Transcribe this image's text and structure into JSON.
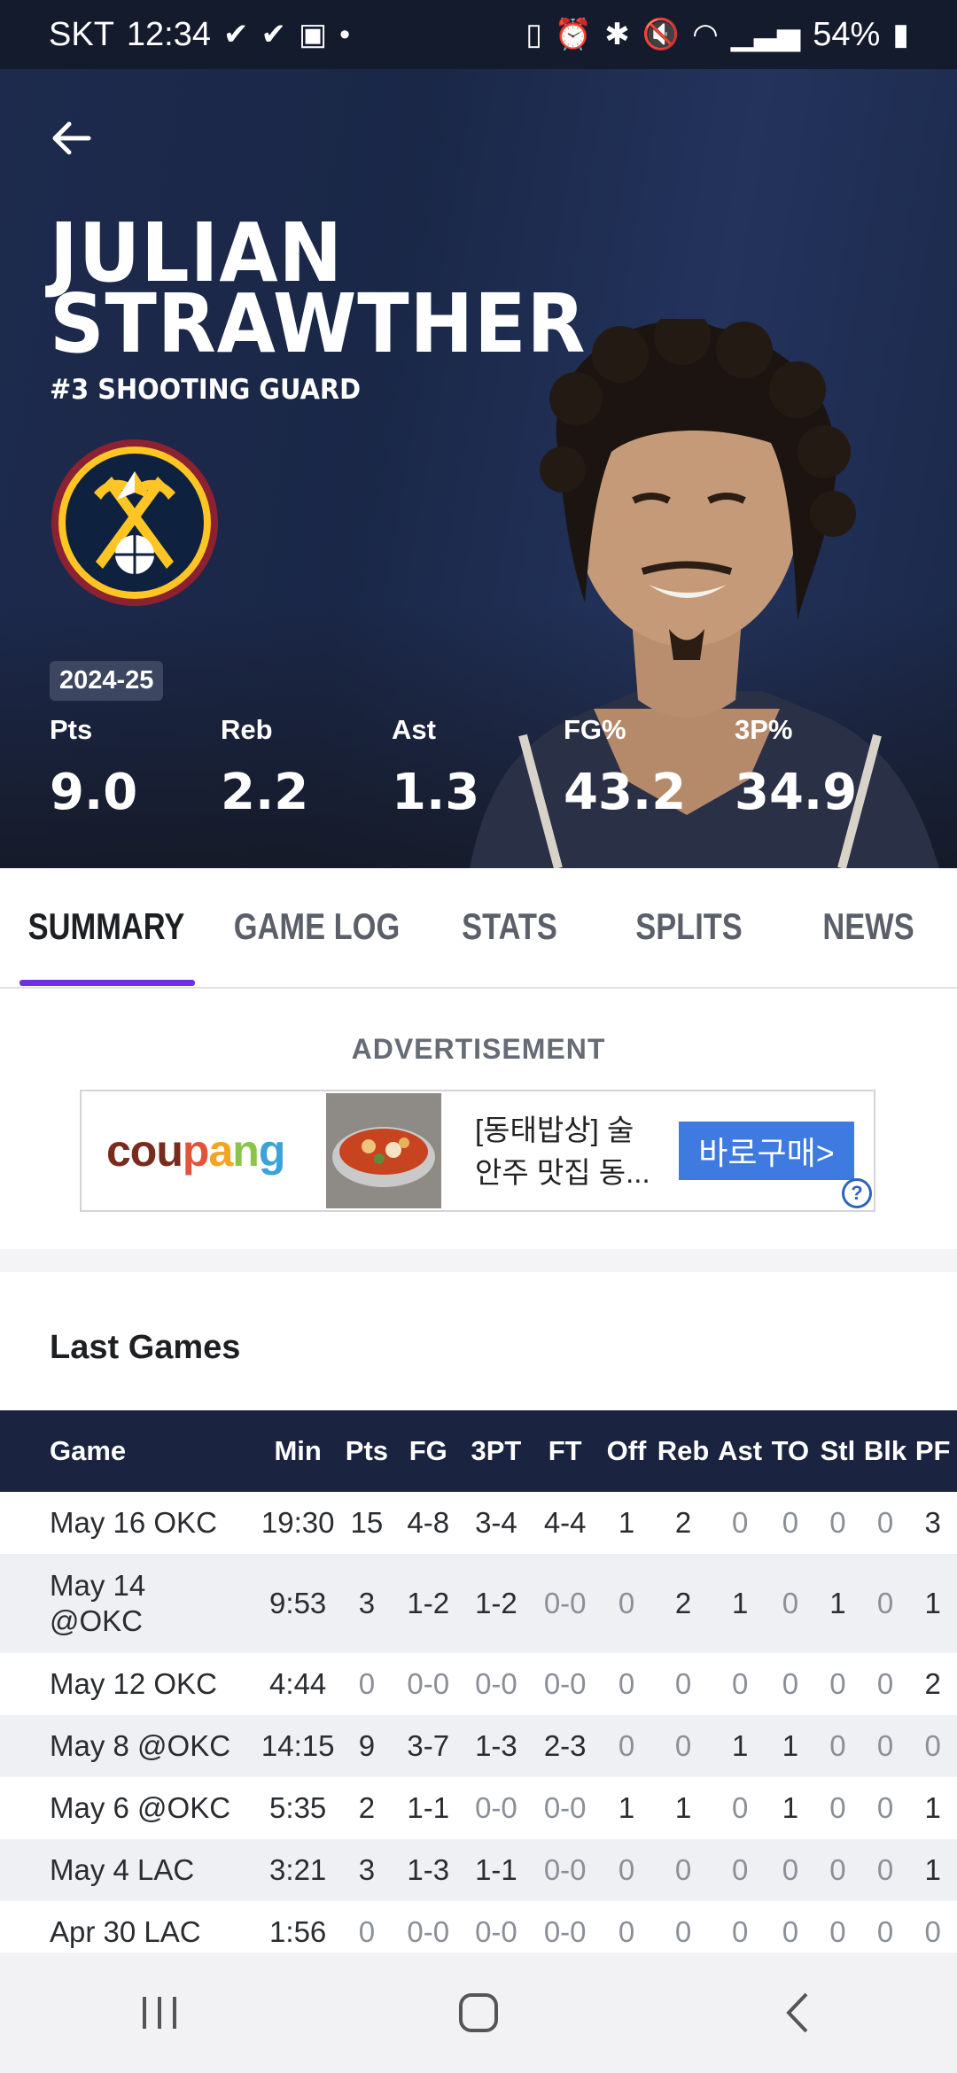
{
  "status_bar": {
    "carrier": "SKT",
    "time": "12:34",
    "battery": "54%",
    "left_icons": [
      "check-icon",
      "check-icon",
      "image-icon",
      "dot-icon"
    ],
    "right_icons": [
      "nfc-icon",
      "alarm-icon",
      "bluetooth-icon",
      "mute-icon",
      "wifi-icon",
      "signal-icon",
      "battery-icon"
    ]
  },
  "player": {
    "first_name": "JULIAN",
    "last_name": "STRAWTHER",
    "position": "#3 SHOOTING GUARD"
  },
  "season": "2024-25",
  "season_stats": [
    {
      "label": "Pts",
      "value": "9.0"
    },
    {
      "label": "Reb",
      "value": "2.2"
    },
    {
      "label": "Ast",
      "value": "1.3"
    },
    {
      "label": "FG%",
      "value": "43.2"
    },
    {
      "label": "3P%",
      "value": "34.9"
    }
  ],
  "tabs": [
    {
      "label": "SUMMARY",
      "active": true
    },
    {
      "label": "GAME LOG",
      "active": false
    },
    {
      "label": "STATS",
      "active": false
    },
    {
      "label": "SPLITS",
      "active": false
    },
    {
      "label": "NEWS",
      "active": false
    }
  ],
  "ad": {
    "label": "ADVERTISEMENT",
    "brand": "coupang",
    "text_line1": "[동태밥상] 술",
    "text_line2": "안주 맛집 동...",
    "cta": "바로구매>",
    "help": "?"
  },
  "last_games": {
    "title": "Last Games",
    "columns": [
      "Game",
      "Min",
      "Pts",
      "FG",
      "3PT",
      "FT",
      "Off",
      "Reb",
      "Ast",
      "TO",
      "Stl",
      "Blk",
      "PF"
    ],
    "rows": [
      [
        "May 16 OKC",
        "19:30",
        "15",
        "4-8",
        "3-4",
        "4-4",
        "1",
        "2",
        "0",
        "0",
        "0",
        "0",
        "3"
      ],
      [
        "May 14 @OKC",
        "9:53",
        "3",
        "1-2",
        "1-2",
        "0-0",
        "0",
        "2",
        "1",
        "0",
        "1",
        "0",
        "1"
      ],
      [
        "May 12 OKC",
        "4:44",
        "0",
        "0-0",
        "0-0",
        "0-0",
        "0",
        "0",
        "0",
        "0",
        "0",
        "0",
        "2"
      ],
      [
        "May 8 @OKC",
        "14:15",
        "9",
        "3-7",
        "1-3",
        "2-3",
        "0",
        "0",
        "1",
        "1",
        "0",
        "0",
        "0"
      ],
      [
        "May 6 @OKC",
        "5:35",
        "2",
        "1-1",
        "0-0",
        "0-0",
        "1",
        "1",
        "0",
        "1",
        "0",
        "0",
        "1"
      ],
      [
        "May 4 LAC",
        "3:21",
        "3",
        "1-3",
        "1-1",
        "0-0",
        "0",
        "0",
        "0",
        "0",
        "0",
        "0",
        "1"
      ],
      [
        "Apr 30 LAC",
        "1:56",
        "0",
        "0-0",
        "0-0",
        "0-0",
        "0",
        "0",
        "0",
        "0",
        "0",
        "0",
        "0"
      ]
    ]
  },
  "colors": {
    "hero_bg": "#1a2747",
    "tab_indicator": "#6e2fe6",
    "table_header_bg": "#1a2340",
    "ad_cta": "#3f7ae0",
    "nuggets_gold": "#fec524",
    "nuggets_navy": "#0e2240",
    "nuggets_red": "#8b2131"
  }
}
